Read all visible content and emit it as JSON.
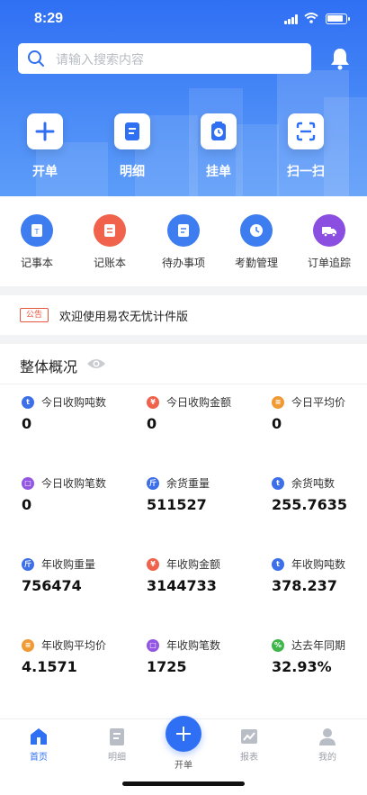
{
  "status_bar": {
    "time": "8:29"
  },
  "search": {
    "placeholder": "请输入搜索内容"
  },
  "quick_actions": [
    {
      "label": "开单",
      "icon": "plus-icon"
    },
    {
      "label": "明细",
      "icon": "document-icon"
    },
    {
      "label": "挂单",
      "icon": "clipboard-clock-icon"
    },
    {
      "label": "扫一扫",
      "icon": "scan-icon"
    }
  ],
  "tools": [
    {
      "label": "记事本",
      "icon": "notepad-icon",
      "color": "#3d7df0"
    },
    {
      "label": "记账本",
      "icon": "ledger-icon",
      "color": "#f0624b"
    },
    {
      "label": "待办事项",
      "icon": "todo-icon",
      "color": "#3d7df0"
    },
    {
      "label": "考勤管理",
      "icon": "clock-icon",
      "color": "#3d7df0"
    },
    {
      "label": "订单追踪",
      "icon": "truck-icon",
      "color": "#8a4fe0"
    }
  ],
  "notice": {
    "tag": "公告",
    "text": "欢迎使用易农无忧计件版"
  },
  "overview": {
    "title": "整体概况",
    "stats": [
      {
        "label": "今日收购吨数",
        "value": "0",
        "badge": "t",
        "color": "#3d6fe8"
      },
      {
        "label": "今日收购金额",
        "value": "0",
        "badge": "¥",
        "color": "#f0624b"
      },
      {
        "label": "今日平均价",
        "value": "0",
        "badge": "≡",
        "color": "#f09a35"
      },
      {
        "label": "今日收购笔数",
        "value": "0",
        "badge": "□",
        "color": "#9356e3"
      },
      {
        "label": "余货重量",
        "value": "511527",
        "badge": "斤",
        "color": "#3d6fe8"
      },
      {
        "label": "余货吨数",
        "value": "255.7635",
        "badge": "t",
        "color": "#3d6fe8"
      },
      {
        "label": "年收购重量",
        "value": "756474",
        "badge": "斤",
        "color": "#3d6fe8"
      },
      {
        "label": "年收购金额",
        "value": "3144733",
        "badge": "¥",
        "color": "#f0624b"
      },
      {
        "label": "年收购吨数",
        "value": "378.237",
        "badge": "t",
        "color": "#3d6fe8"
      },
      {
        "label": "年收购平均价",
        "value": "4.1571",
        "badge": "≡",
        "color": "#f09a35"
      },
      {
        "label": "年收购笔数",
        "value": "1725",
        "badge": "□",
        "color": "#9356e3"
      },
      {
        "label": "达去年同期",
        "value": "32.93%",
        "badge": "%",
        "color": "#3fb64a"
      }
    ]
  },
  "tabbar": {
    "items": [
      {
        "label": "首页",
        "icon": "home-icon"
      },
      {
        "label": "明细",
        "icon": "document-icon"
      },
      {
        "label": "开单",
        "icon": "plus-icon"
      },
      {
        "label": "报表",
        "icon": "chart-icon"
      },
      {
        "label": "我的",
        "icon": "user-icon"
      }
    ],
    "active": "首页"
  },
  "colors": {
    "primary": "#2f6ff3"
  }
}
